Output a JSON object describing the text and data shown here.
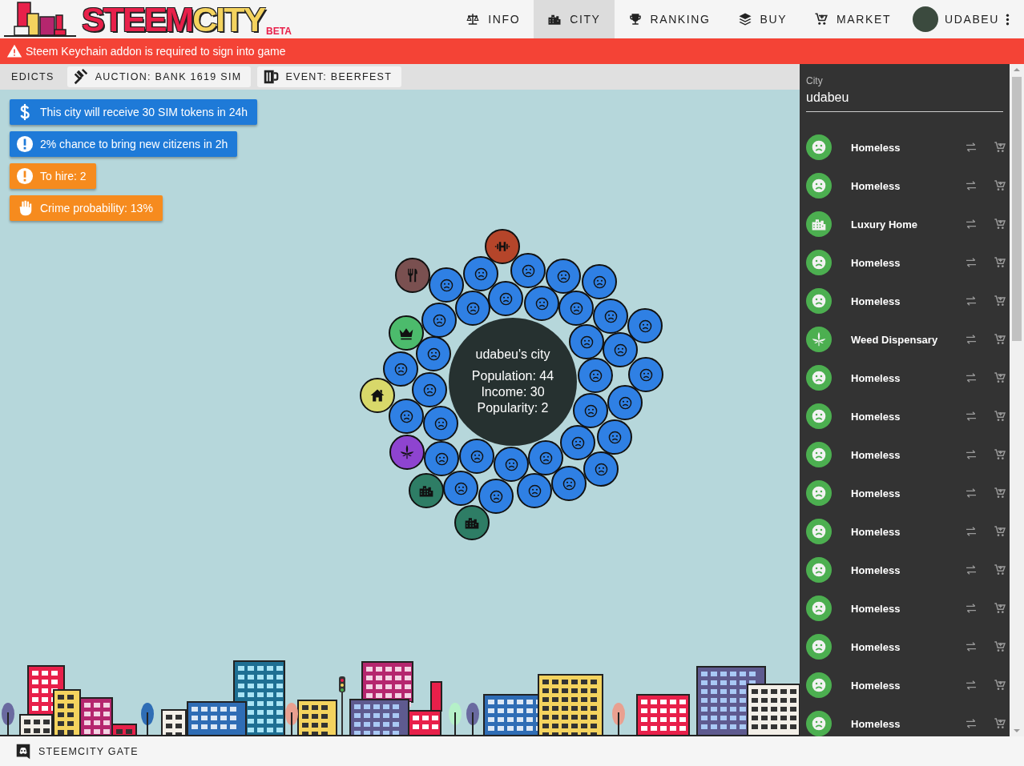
{
  "header": {
    "logo_text": "STEEM**CITY**",
    "logo_badge": "BETA",
    "nav": [
      {
        "label": "INFO",
        "kind": "scale",
        "selected": false
      },
      {
        "label": "CITY",
        "kind": "city",
        "selected": true
      },
      {
        "label": "RANKING",
        "kind": "trophy",
        "selected": false
      },
      {
        "label": "BUY",
        "kind": "layers",
        "selected": false
      },
      {
        "label": "MARKET",
        "kind": "cart",
        "selected": false
      }
    ],
    "user": {
      "name": "UDABEU"
    }
  },
  "alert": {
    "text": "Steem Keychain addon is required to sign into game"
  },
  "toolbar": [
    {
      "label": "EDICTS",
      "kind": "plain"
    },
    {
      "label": "AUCTION: BANK 1619 SIM",
      "kind": "gavel"
    },
    {
      "label": "EVENT: BEERFEST",
      "kind": "mug"
    }
  ],
  "notices": [
    {
      "text": "This city will receive 30 SIM tokens in 24h",
      "kind": "dollar",
      "color": "#1e7ad8"
    },
    {
      "text": "2% chance to bring new citizens in 2h",
      "kind": "alert",
      "color": "#1e7ad8"
    },
    {
      "text": "To hire: 2",
      "kind": "alert",
      "color": "#f68b1e"
    },
    {
      "text": "Crime probability: 13%",
      "kind": "hand",
      "color": "#f68b1e"
    }
  ],
  "city_map": {
    "title": "udabeu's city",
    "stats": [
      "Population: 44",
      "Income: 30",
      "Popularity: 2"
    ],
    "buildings": [
      {
        "kind": "gym",
        "color": "#b5452a"
      },
      {
        "kind": "restaurant",
        "color": "#7a5050"
      },
      {
        "kind": "crown",
        "color": "#4cbb6c"
      },
      {
        "kind": "house",
        "color": "#d8d86a"
      },
      {
        "kind": "weed",
        "color": "#8e44d0"
      },
      {
        "kind": "block",
        "color": "#2e7d65"
      },
      {
        "kind": "block",
        "color": "#2e7d65"
      }
    ],
    "citizens": [
      {
        "kind": "sad"
      },
      {
        "kind": "sad"
      },
      {
        "kind": "sad"
      },
      {
        "kind": "sad"
      },
      {
        "kind": "sad"
      },
      {
        "kind": "sad"
      },
      {
        "kind": "sad"
      },
      {
        "kind": "sad"
      },
      {
        "kind": "sad"
      },
      {
        "kind": "sad"
      },
      {
        "kind": "sad"
      },
      {
        "kind": "sad"
      },
      {
        "kind": "sad"
      },
      {
        "kind": "sad"
      },
      {
        "kind": "sad"
      },
      {
        "kind": "sad"
      },
      {
        "kind": "sad"
      },
      {
        "kind": "sad"
      },
      {
        "kind": "sad"
      },
      {
        "kind": "sad"
      },
      {
        "kind": "sad"
      },
      {
        "kind": "sad"
      },
      {
        "kind": "sad"
      },
      {
        "kind": "sad"
      },
      {
        "kind": "sad"
      },
      {
        "kind": "sad"
      },
      {
        "kind": "sad"
      },
      {
        "kind": "sad"
      },
      {
        "kind": "sad"
      },
      {
        "kind": "sad"
      },
      {
        "kind": "sad"
      },
      {
        "kind": "sad"
      },
      {
        "kind": "sad"
      },
      {
        "kind": "sad"
      }
    ]
  },
  "sidebar": {
    "field_label": "City",
    "field_value": "udabeu",
    "items": [
      {
        "name": "Homeless",
        "kind": "homeless"
      },
      {
        "name": "Homeless",
        "kind": "homeless"
      },
      {
        "name": "Luxury Home",
        "kind": "luxury"
      },
      {
        "name": "Homeless",
        "kind": "homeless"
      },
      {
        "name": "Homeless",
        "kind": "homeless"
      },
      {
        "name": "Weed Dispensary",
        "kind": "weed"
      },
      {
        "name": "Homeless",
        "kind": "homeless"
      },
      {
        "name": "Homeless",
        "kind": "homeless"
      },
      {
        "name": "Homeless",
        "kind": "homeless"
      },
      {
        "name": "Homeless",
        "kind": "homeless"
      },
      {
        "name": "Homeless",
        "kind": "homeless"
      },
      {
        "name": "Homeless",
        "kind": "homeless"
      },
      {
        "name": "Homeless",
        "kind": "homeless"
      },
      {
        "name": "Homeless",
        "kind": "homeless"
      },
      {
        "name": "Homeless",
        "kind": "homeless"
      },
      {
        "name": "Homeless",
        "kind": "homeless"
      }
    ]
  },
  "footer": {
    "link": "STEEMCITY GATE"
  }
}
